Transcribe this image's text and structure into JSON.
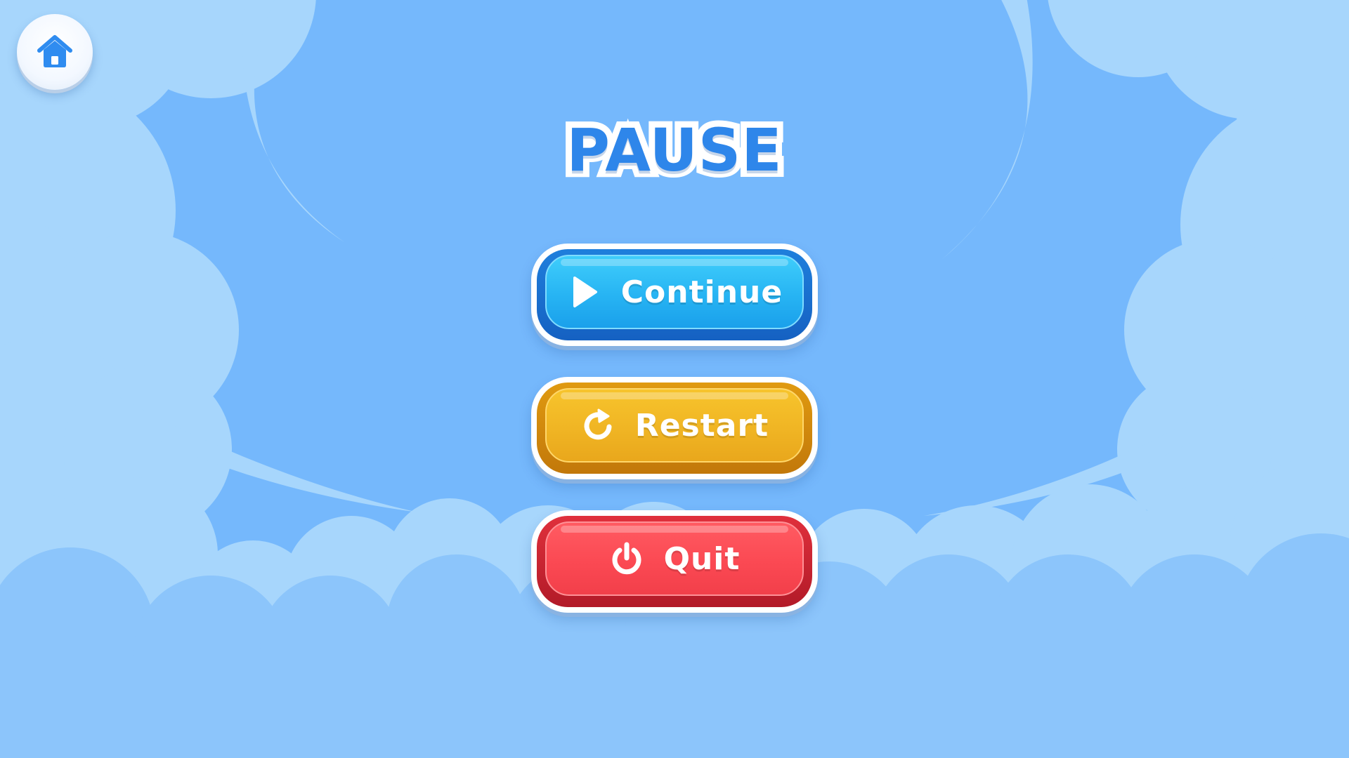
{
  "screen": {
    "title": "PAUSE"
  },
  "home_button": {
    "icon": "home-icon"
  },
  "menu": {
    "continue": {
      "label": "Continue",
      "icon": "play-icon",
      "color": "#27b4f3"
    },
    "restart": {
      "label": "Restart",
      "icon": "restart-icon",
      "color": "#f0b524"
    },
    "quit": {
      "label": "Quit",
      "icon": "power-icon",
      "color": "#fb4953"
    }
  },
  "theme": {
    "background": "#75b8fc",
    "cloud_light": "#a7d6fc",
    "cloud_mid": "#8cc5fb",
    "title_color": "#2e86ea"
  }
}
